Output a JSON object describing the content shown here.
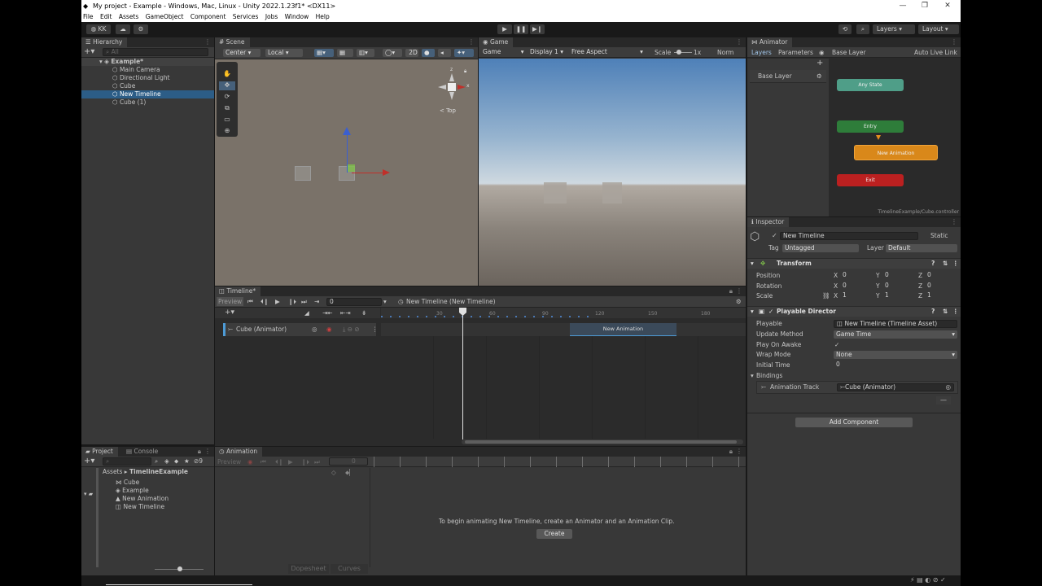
{
  "window": {
    "title": "My project - Example - Windows, Mac, Linux - Unity 2022.1.23f1* <DX11>",
    "menu": [
      "File",
      "Edit",
      "Assets",
      "GameObject",
      "Component",
      "Services",
      "Jobs",
      "Window",
      "Help"
    ]
  },
  "toolbar": {
    "account": "KK",
    "layers": "Layers",
    "layout": "Layout"
  },
  "hierarchy": {
    "tab": "Hierarchy",
    "search_placeholder": "All",
    "scene": "Example*",
    "items": [
      "Main Camera",
      "Directional Light",
      "Cube",
      "New Timeline",
      "Cube (1)"
    ],
    "selected": "New Timeline"
  },
  "scene": {
    "tab": "Scene",
    "pivot": "Center",
    "space": "Local",
    "mode_2d": "2D",
    "view": "< Top",
    "gizmo_x": "x",
    "gizmo_z": "z"
  },
  "game": {
    "tab": "Game",
    "view": "Game",
    "display": "Display 1",
    "aspect": "Free Aspect",
    "scale_label": "Scale",
    "scale_value": "1x",
    "mode": "Norm"
  },
  "animator": {
    "tab": "Animator",
    "sub_tabs": [
      "Layers",
      "Parameters"
    ],
    "breadcrumb": "Base Layer",
    "auto_live": "Auto Live Link",
    "layer": "Base Layer",
    "states": {
      "any": "Any State",
      "entry": "Entry",
      "anim": "New Animation",
      "exit": "Exit"
    },
    "footer": "TimelineExample/Cube.controller"
  },
  "timeline": {
    "tab": "Timeline*",
    "preview": "Preview",
    "frame": "0",
    "asset": "New Timeline (New Timeline)",
    "ticks": [
      "30",
      "60",
      "90",
      "120",
      "150",
      "180"
    ],
    "track": "Cube (Animator)",
    "clip": "New Animation"
  },
  "inspector": {
    "tab": "Inspector",
    "name": "New Timeline",
    "static": "Static",
    "tag_label": "Tag",
    "tag": "Untagged",
    "layer_label": "Layer",
    "layer": "Default",
    "transform": {
      "title": "Transform",
      "rows": [
        {
          "label": "Position",
          "x": "0",
          "y": "0",
          "z": "0"
        },
        {
          "label": "Rotation",
          "x": "0",
          "y": "0",
          "z": "0"
        },
        {
          "label": "Scale",
          "x": "1",
          "y": "1",
          "z": "1"
        }
      ]
    },
    "director": {
      "title": "Playable Director",
      "playable_label": "Playable",
      "playable": "New Timeline (Timeline Asset)",
      "update_label": "Update Method",
      "update": "Game Time",
      "awake_label": "Play On Awake",
      "awake": "✓",
      "wrap_label": "Wrap Mode",
      "wrap": "None",
      "initial_label": "Initial Time",
      "initial": "0",
      "bindings_label": "Bindings",
      "binding_track": "Animation Track",
      "binding_value": "Cube (Animator)"
    },
    "add_component": "Add Component"
  },
  "project": {
    "tabs": [
      "Project",
      "Console"
    ],
    "breadcrumb_root": "Assets",
    "breadcrumb_leaf": "TimelineExample",
    "assets": [
      "Cube",
      "Example",
      "New Animation",
      "New Timeline"
    ],
    "hidden_count": "9"
  },
  "animation": {
    "tab": "Animation",
    "preview": "Preview",
    "frame": "0",
    "message": "To begin animating New Timeline, create an Animator and an Animation Clip.",
    "create": "Create",
    "dopesheet": "Dopesheet",
    "curves": "Curves"
  }
}
